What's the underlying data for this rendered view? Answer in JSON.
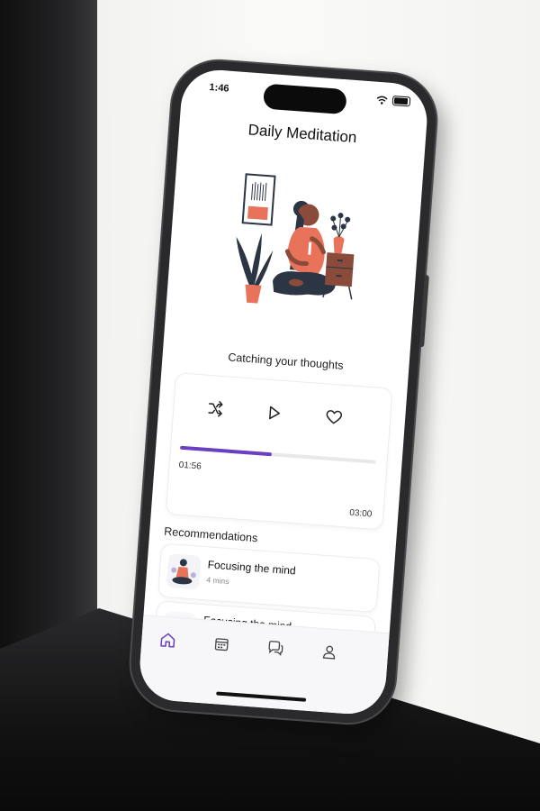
{
  "status_bar": {
    "time": "1:46"
  },
  "screen": {
    "title": "Daily Meditation",
    "caption": "Catching your thoughts"
  },
  "player": {
    "current_time": "01:56",
    "total_time": "03:00",
    "progress": 0.47,
    "controls": [
      "shuffle-icon",
      "play-icon",
      "heart-icon"
    ]
  },
  "recommendations": {
    "heading": "Recommendations",
    "items": [
      {
        "title": "Focusing the mind",
        "duration": "4 mins"
      },
      {
        "title": "Focusing the mind",
        "duration": ""
      }
    ]
  },
  "tab_bar": {
    "items": [
      "home-icon",
      "calendar-icon",
      "chat-icon",
      "profile-icon"
    ],
    "active": "home-icon"
  },
  "colors": {
    "accent": "#6a3fc1",
    "illustration": "#e8735a",
    "plant": "#2b3544"
  }
}
